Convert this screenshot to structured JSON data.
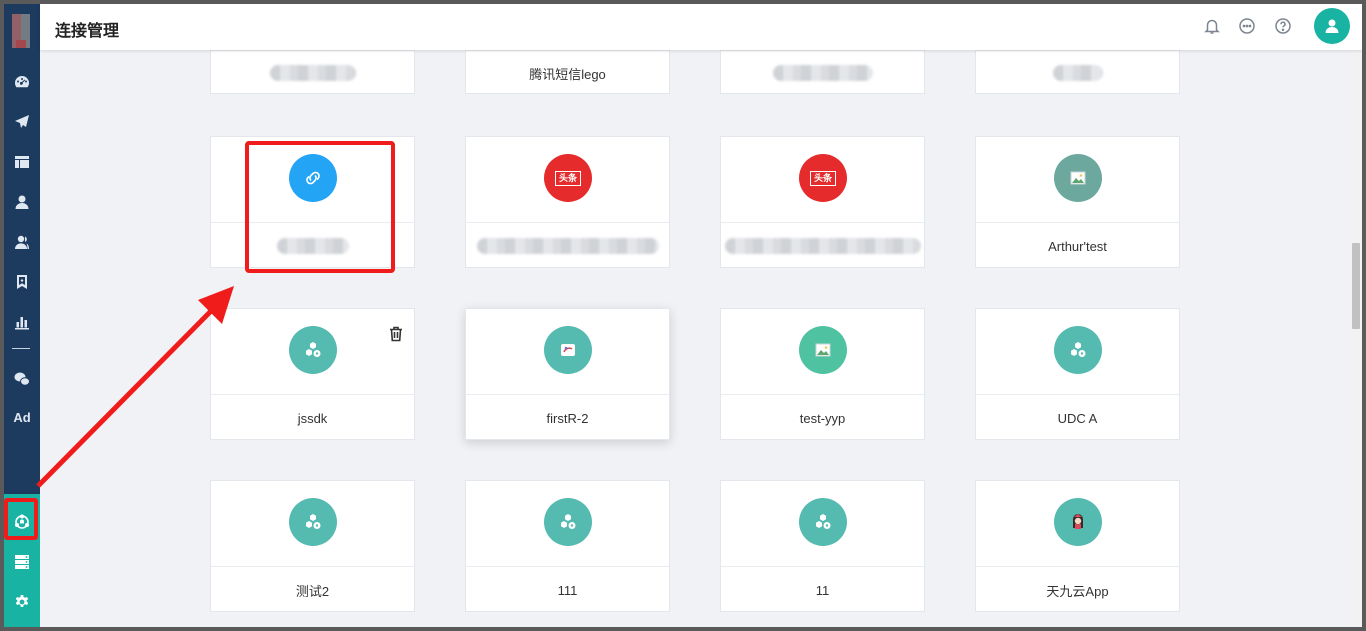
{
  "header": {
    "title": "连接管理"
  },
  "sidebar": {
    "ad_label": "Ad"
  },
  "cards": [
    {
      "name": "",
      "blurred": true
    },
    {
      "name": "腾讯短信lego",
      "blurred": false
    },
    {
      "name": "",
      "blurred": true
    },
    {
      "name": "",
      "blurred": true
    },
    {
      "name": "",
      "blurred": true
    },
    {
      "name": "",
      "blurred": true
    },
    {
      "name": "",
      "blurred": true
    },
    {
      "name": "Arthur'test",
      "blurred": false
    },
    {
      "name": "jssdk",
      "blurred": false
    },
    {
      "name": "firstR-2",
      "blurred": false
    },
    {
      "name": "test-yyp",
      "blurred": false
    },
    {
      "name": "UDC A",
      "blurred": false
    },
    {
      "name": "测试2",
      "blurred": false
    },
    {
      "name": "111",
      "blurred": false
    },
    {
      "name": "11",
      "blurred": false
    },
    {
      "name": "天九云App",
      "blurred": false
    }
  ],
  "badges": {
    "toutiao_text": "头条"
  },
  "colors": {
    "sidebar": "#1d3a5f",
    "sidebar_accent": "#18b3a2",
    "highlight": "#f01c1c",
    "sdk_badge": "#55bab0",
    "toutiao_badge": "#e52b2b",
    "link_badge": "#24a4f5"
  }
}
